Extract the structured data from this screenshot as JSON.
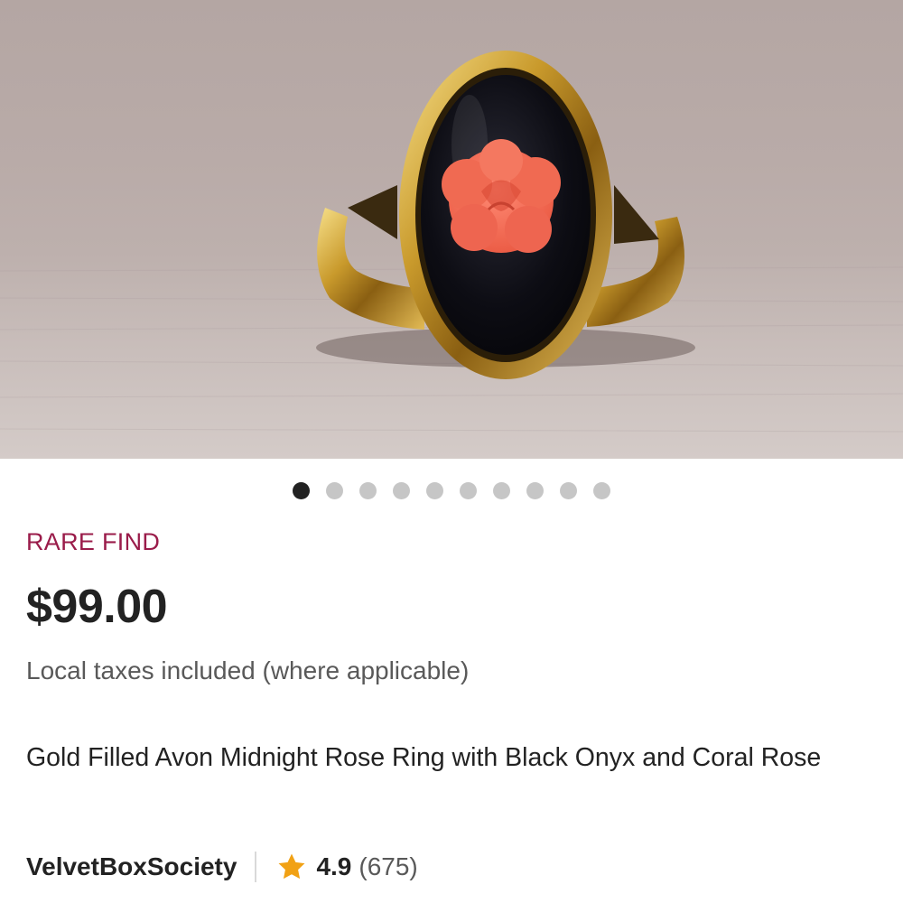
{
  "listing": {
    "badge": "RARE FIND",
    "price": "$99.00",
    "tax_note": "Local taxes included (where applicable)",
    "title": "Gold Filled Avon Midnight Rose Ring with Black Onyx and Coral Rose"
  },
  "carousel": {
    "total": 10,
    "active_index": 0
  },
  "shop": {
    "name": "VelvetBoxSociety",
    "rating": "4.9",
    "review_count": "(675)"
  },
  "colors": {
    "badge": "#9a1c4a",
    "star": "#f1a114",
    "text": "#222222",
    "muted": "#595959"
  },
  "icons": {
    "rating": "star-icon"
  }
}
